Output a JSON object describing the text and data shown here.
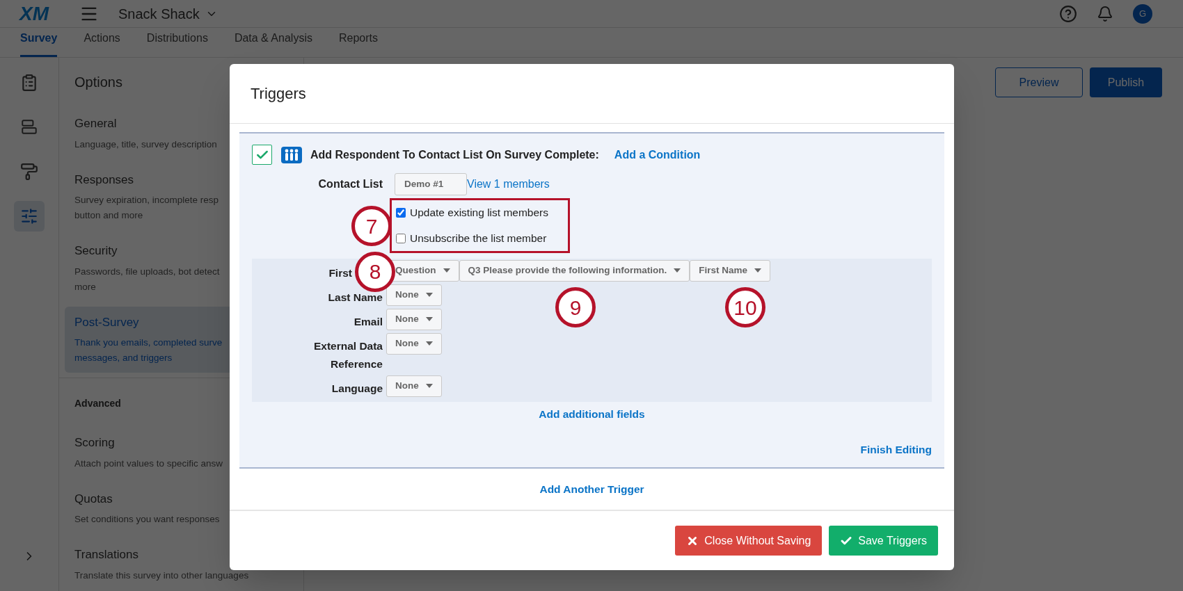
{
  "app": {
    "logo": "XM",
    "project": "Snack Shack",
    "avatar": "G"
  },
  "nav_tabs": [
    {
      "label": "Survey",
      "selected": true
    },
    {
      "label": "Actions",
      "selected": false
    },
    {
      "label": "Distributions",
      "selected": false
    },
    {
      "label": "Data & Analysis",
      "selected": false
    },
    {
      "label": "Reports",
      "selected": false
    }
  ],
  "rail_icons": [
    {
      "kind": "clipboard",
      "selected": false
    },
    {
      "kind": "blocks",
      "selected": false
    },
    {
      "kind": "brush",
      "selected": false
    },
    {
      "kind": "options",
      "selected": true
    }
  ],
  "options": {
    "title": "Options",
    "sections": [
      {
        "title": "General",
        "description": [
          "Language, title, survey description"
        ],
        "selected": false
      },
      {
        "title": "Responses",
        "description": [
          "Survey expiration, incomplete resp",
          "button and more"
        ],
        "selected": false
      },
      {
        "title": "Security",
        "description": [
          "Passwords, file uploads, bot detect",
          "more"
        ],
        "selected": false
      },
      {
        "title": "Post-Survey",
        "description": [
          "Thank you emails, completed surve",
          "messages, and triggers"
        ],
        "selected": true
      }
    ],
    "advanced_heading": "Advanced",
    "advanced_sections": [
      {
        "title": "Scoring",
        "description": [
          "Attach point values to specific answ"
        ],
        "selected": false
      },
      {
        "title": "Quotas",
        "description": [
          "Set conditions you want responses"
        ],
        "selected": false
      },
      {
        "title": "Translations",
        "description": [
          "Translate this survey into other languages"
        ],
        "selected": false
      }
    ]
  },
  "header_buttons": [
    "Preview",
    "Publish"
  ],
  "modal": {
    "title": "Triggers",
    "trigger": {
      "enabled": true,
      "title": "Add Respondent To Contact List On Survey Complete:",
      "condition_link": "Add a Condition",
      "contact_list_label": "Contact List",
      "contact_list": "Demo #1",
      "members_link": "View 1 members",
      "options": [
        {
          "label": "Update existing list members",
          "checked": true
        },
        {
          "label": "Unsubscribe the list member",
          "checked": false
        }
      ],
      "fields": [
        {
          "label": "First",
          "callout": "8",
          "selects": [
            "Question",
            "Q3 Please provide the following information.",
            "First Name"
          ]
        },
        {
          "label": "Last Name",
          "selects": [
            "None"
          ]
        },
        {
          "label": "Email",
          "selects": [
            "None"
          ]
        },
        {
          "label": "External Data Reference",
          "selects": [
            "None"
          ]
        },
        {
          "label": "Language",
          "selects": [
            "None"
          ]
        }
      ],
      "add_fields_link": "Add additional fields",
      "finish_link": "Finish Editing"
    },
    "add_trigger_link": "Add Another Trigger",
    "close_button": "Close Without Saving",
    "save_button": "Save Triggers",
    "callouts": [
      "7",
      "9",
      "10"
    ]
  }
}
